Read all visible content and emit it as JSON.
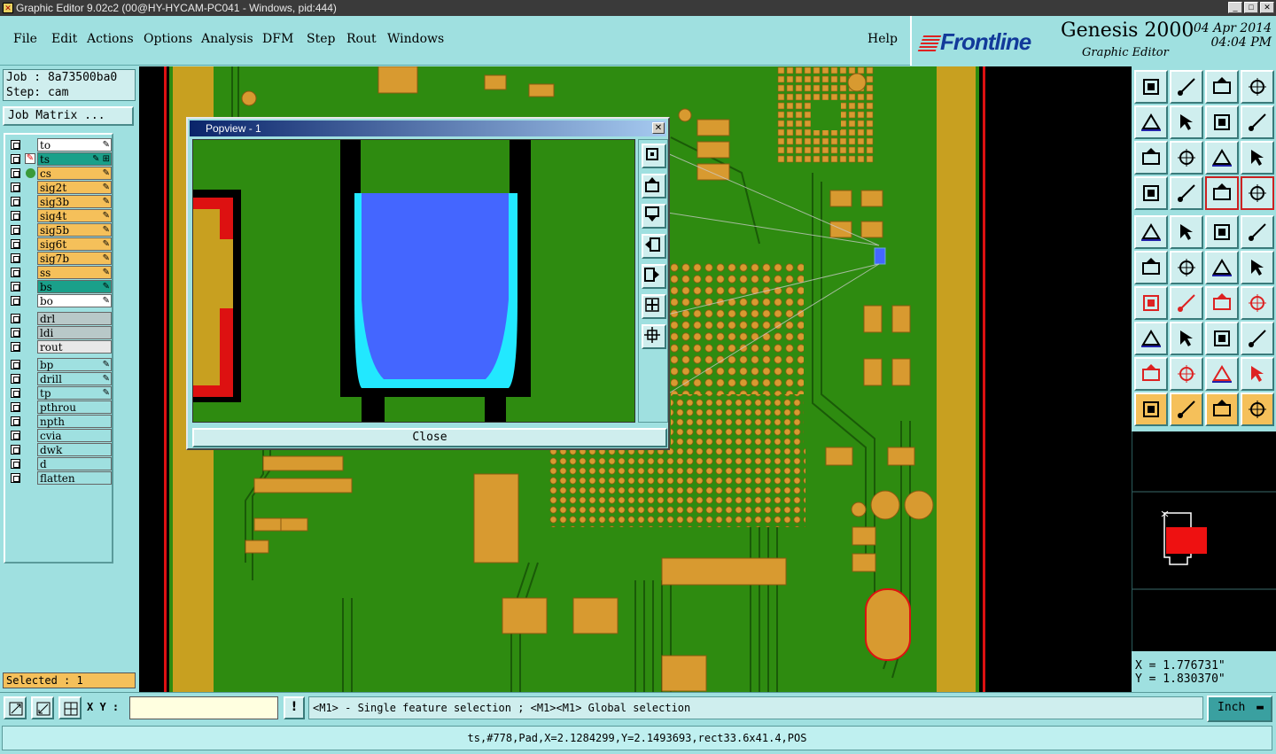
{
  "window": {
    "title": "Graphic Editor 9.02c2 (00@HY-HYCAM-PC041 - Windows, pid:444)"
  },
  "menu": {
    "items": [
      "File",
      "Edit",
      "Actions",
      "Options",
      "Analysis",
      "DFM",
      "Step",
      "Rout",
      "Windows"
    ],
    "help": "Help"
  },
  "brand": {
    "logo": "Frontline",
    "product": "Genesis 2000",
    "subtitle": "Graphic Editor",
    "date": "04 Apr 2014",
    "time": "04:04 PM"
  },
  "job": {
    "job_label": "Job : 8a73500ba0",
    "step_label": "Step: cam",
    "matrix_button": "Job Matrix ..."
  },
  "layers": [
    {
      "name": "to",
      "color": "#ffffff",
      "icon": "✎"
    },
    {
      "name": "ts",
      "color": "#1aa08a",
      "icon": "✎ ⊞",
      "active": true
    },
    {
      "name": "cs",
      "color": "#f5c05a",
      "icon": "✎"
    },
    {
      "name": "sig2t",
      "color": "#f5c05a",
      "icon": "✎"
    },
    {
      "name": "sig3b",
      "color": "#f5c05a",
      "icon": "✎"
    },
    {
      "name": "sig4t",
      "color": "#f5c05a",
      "icon": "✎"
    },
    {
      "name": "sig5b",
      "color": "#f5c05a",
      "icon": "✎"
    },
    {
      "name": "sig6t",
      "color": "#f5c05a",
      "icon": "✎"
    },
    {
      "name": "sig7b",
      "color": "#f5c05a",
      "icon": "✎"
    },
    {
      "name": "ss",
      "color": "#f5c05a",
      "icon": "✎"
    },
    {
      "name": "bs",
      "color": "#1aa08a",
      "icon": "✎"
    },
    {
      "name": "bo",
      "color": "#ffffff",
      "icon": "✎"
    },
    {
      "name": "drl",
      "color": "#b8c8c8",
      "icon": ""
    },
    {
      "name": "ldi",
      "color": "#b8c8c8",
      "icon": ""
    },
    {
      "name": "rout",
      "color": "#e8e8e8",
      "icon": ""
    },
    {
      "name": "bp",
      "color": "#9fe0e0",
      "icon": "✎"
    },
    {
      "name": "drill",
      "color": "#9fe0e0",
      "icon": "✎"
    },
    {
      "name": "tp",
      "color": "#9fe0e0",
      "icon": "✎"
    },
    {
      "name": "pthrou",
      "color": "#9fe0e0",
      "icon": ""
    },
    {
      "name": "npth",
      "color": "#9fe0e0",
      "icon": ""
    },
    {
      "name": "cvia",
      "color": "#9fe0e0",
      "icon": ""
    },
    {
      "name": "dwk",
      "color": "#9fe0e0",
      "icon": ""
    },
    {
      "name": "d",
      "color": "#9fe0e0",
      "icon": ""
    },
    {
      "name": "flatten",
      "color": "#9fe0e0",
      "icon": ""
    }
  ],
  "selected": "Selected : 1",
  "popup": {
    "title": "Popview - 1",
    "close_label": "Close"
  },
  "coords": {
    "x": "X = 1.776731\"",
    "y": "Y = 1.830370\""
  },
  "bottombar": {
    "xy_label": "X Y :",
    "xy_value": "",
    "hint": "<M1> - Single feature selection ; <M1><M1> Global selection",
    "units": "Inch"
  },
  "status": "ts,#778,Pad,X=2.1284299,Y=2.1493693,rect33.6x41.4,POS",
  "colors": {
    "board": "#2e8b10",
    "copper": "#c8a020",
    "pad": "#e0a030",
    "highlight": "#4466ff",
    "outline": "#dd1111"
  }
}
